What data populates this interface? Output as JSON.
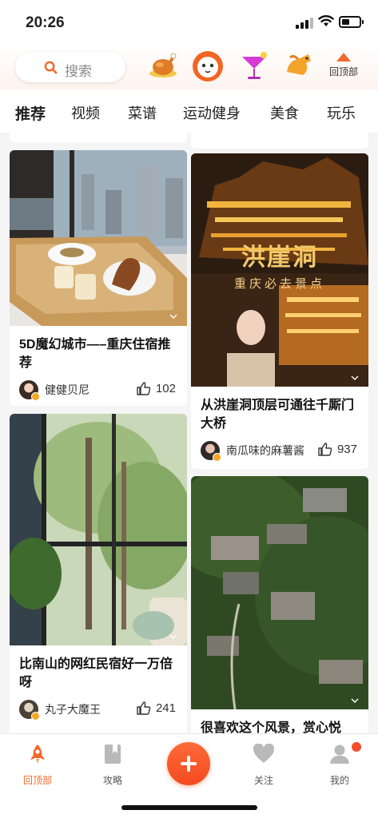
{
  "status": {
    "time": "20:26"
  },
  "topbar": {
    "search_label": "搜索",
    "channel_icons": [
      "roast-chicken-icon",
      "lion-face-icon",
      "cocktail-icon",
      "horse-icon"
    ],
    "back_top_label": "回顶部"
  },
  "tabs": [
    {
      "label": "推荐",
      "active": true
    },
    {
      "label": "视频"
    },
    {
      "label": "菜谱"
    },
    {
      "label": "运动健身"
    },
    {
      "label": "美食"
    },
    {
      "label": "玩乐"
    }
  ],
  "feed": {
    "cards": [
      {
        "title": "5D魔幻城市—–重庆住宿推荐",
        "author": "健健贝尼",
        "likes": "102"
      },
      {
        "title": "比南山的网红民宿好一万倍呀",
        "author": "丸子大魔王",
        "likes": "241"
      },
      {
        "image_text": [
          "洪崖洞",
          "重庆必去景点"
        ],
        "title": "从洪崖洞顶层可通往千厮门大桥",
        "author": "南瓜味的麻薯酱",
        "likes": "937"
      },
      {
        "title": "很喜欢这个风景，赏心悦"
      }
    ]
  },
  "tabbar": {
    "items": [
      {
        "label": "回顶部",
        "icon": "rocket-icon",
        "active": true
      },
      {
        "label": "攻略",
        "icon": "bookmark-book-icon"
      },
      {
        "label": "",
        "icon": "plus-icon"
      },
      {
        "label": "关注",
        "icon": "heart-icon"
      },
      {
        "label": "我的",
        "icon": "user-icon"
      }
    ]
  },
  "colors": {
    "accent": "#f06a2c",
    "plus_button": "#f34a1e",
    "badge": "#f24e2a"
  }
}
